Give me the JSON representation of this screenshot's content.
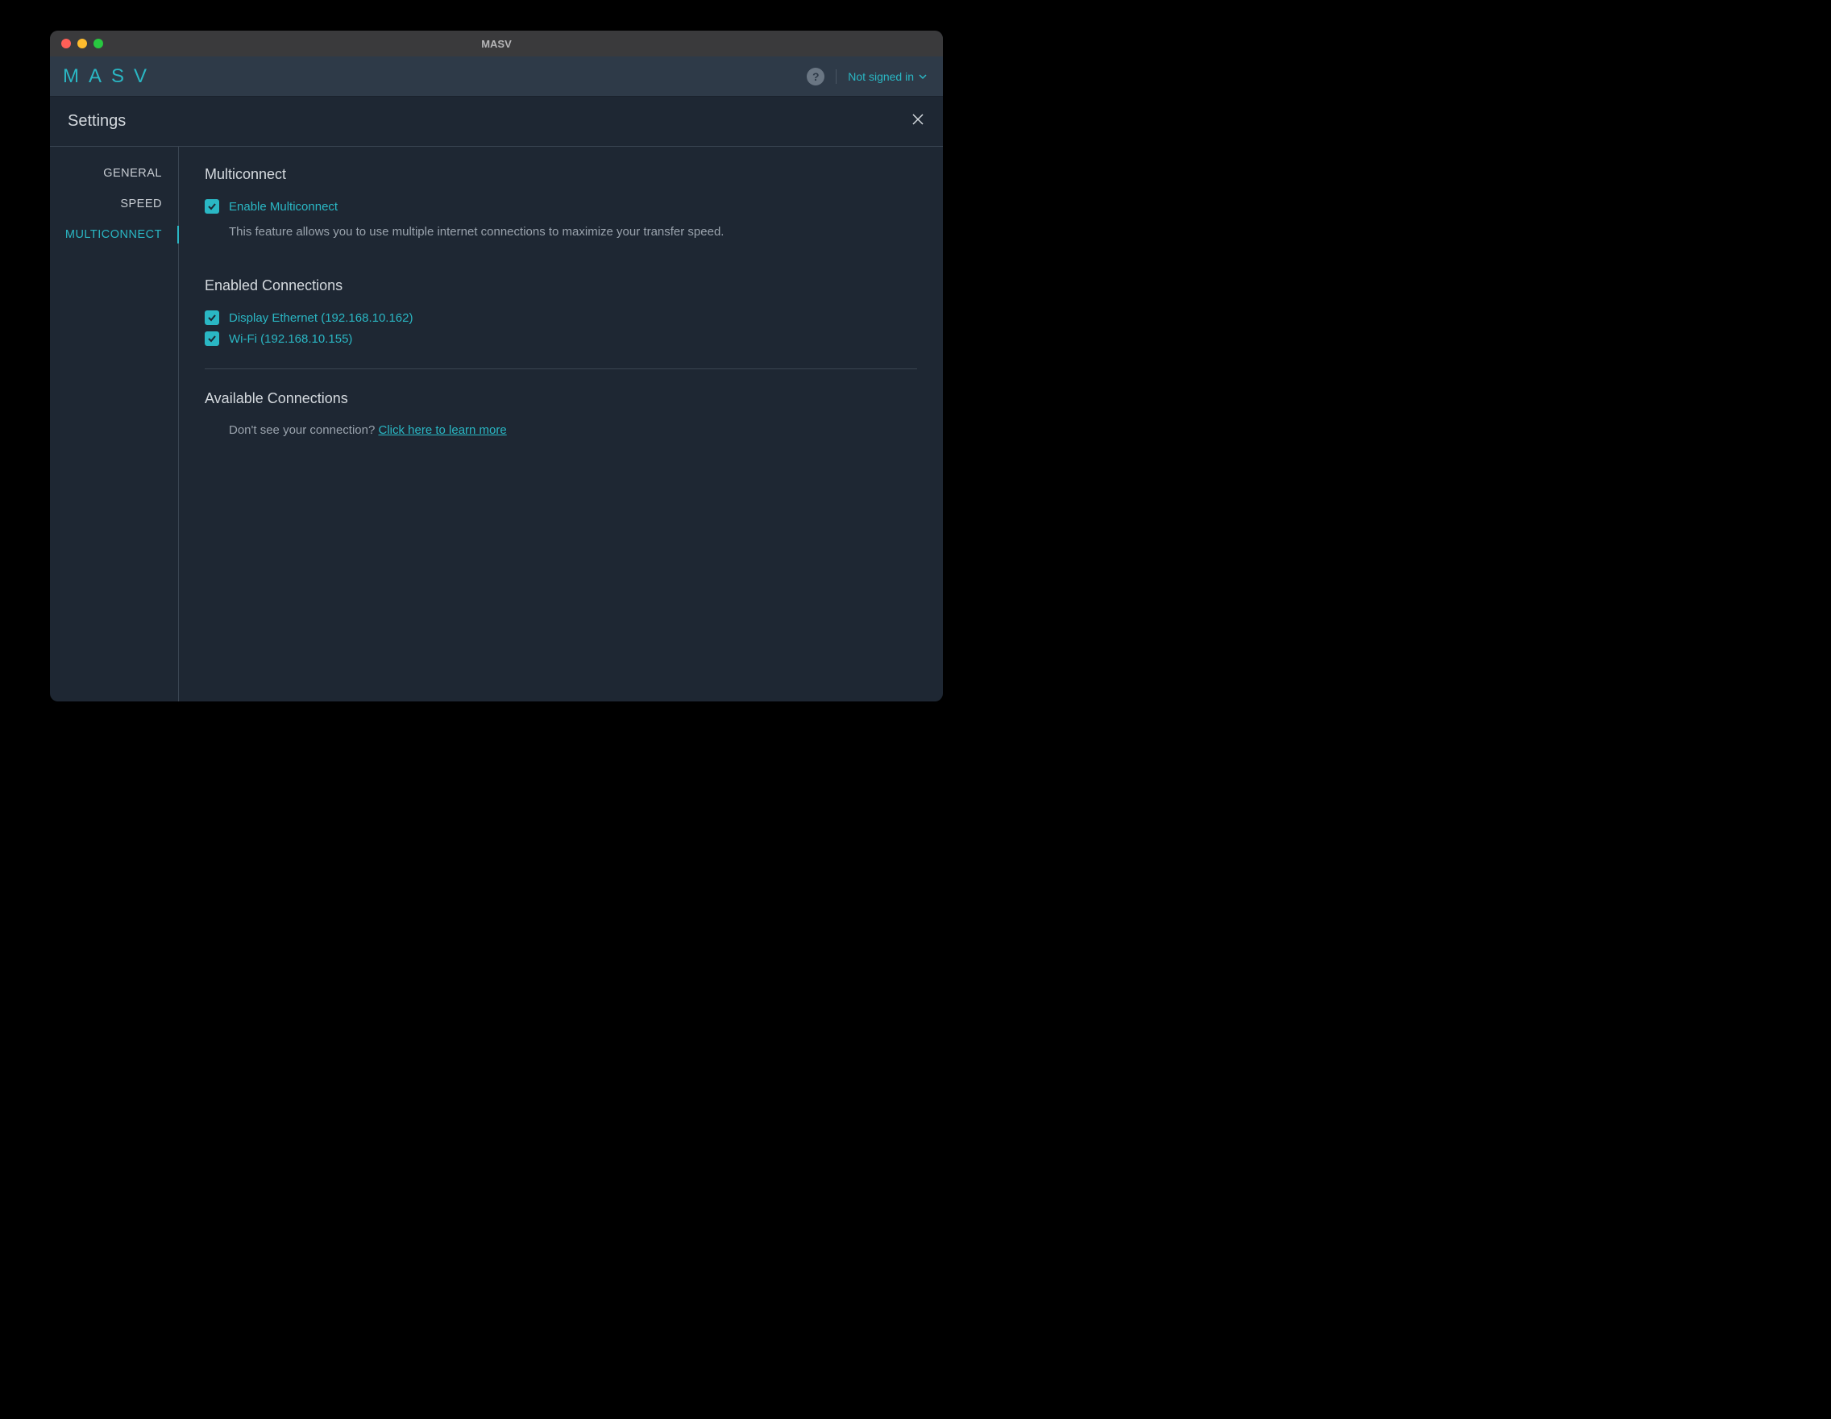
{
  "window": {
    "title": "MASV"
  },
  "topbar": {
    "logo_text": "MASV",
    "signin_label": "Not signed in"
  },
  "settings": {
    "title": "Settings"
  },
  "sidebar": {
    "items": [
      {
        "label": "GENERAL",
        "active": false
      },
      {
        "label": "SPEED",
        "active": false
      },
      {
        "label": "MULTICONNECT",
        "active": true
      }
    ]
  },
  "multiconnect": {
    "heading": "Multiconnect",
    "enable_label": "Enable Multiconnect",
    "description": "This feature allows you to use multiple internet connections to maximize your transfer speed.",
    "enabled_connections_heading": "Enabled Connections",
    "connections": [
      {
        "label": "Display Ethernet (192.168.10.162)"
      },
      {
        "label": "Wi-Fi (192.168.10.155)"
      }
    ],
    "available_connections_heading": "Available Connections",
    "help_prefix": "Don't see your connection?  ",
    "help_link": "Click here to learn more"
  }
}
